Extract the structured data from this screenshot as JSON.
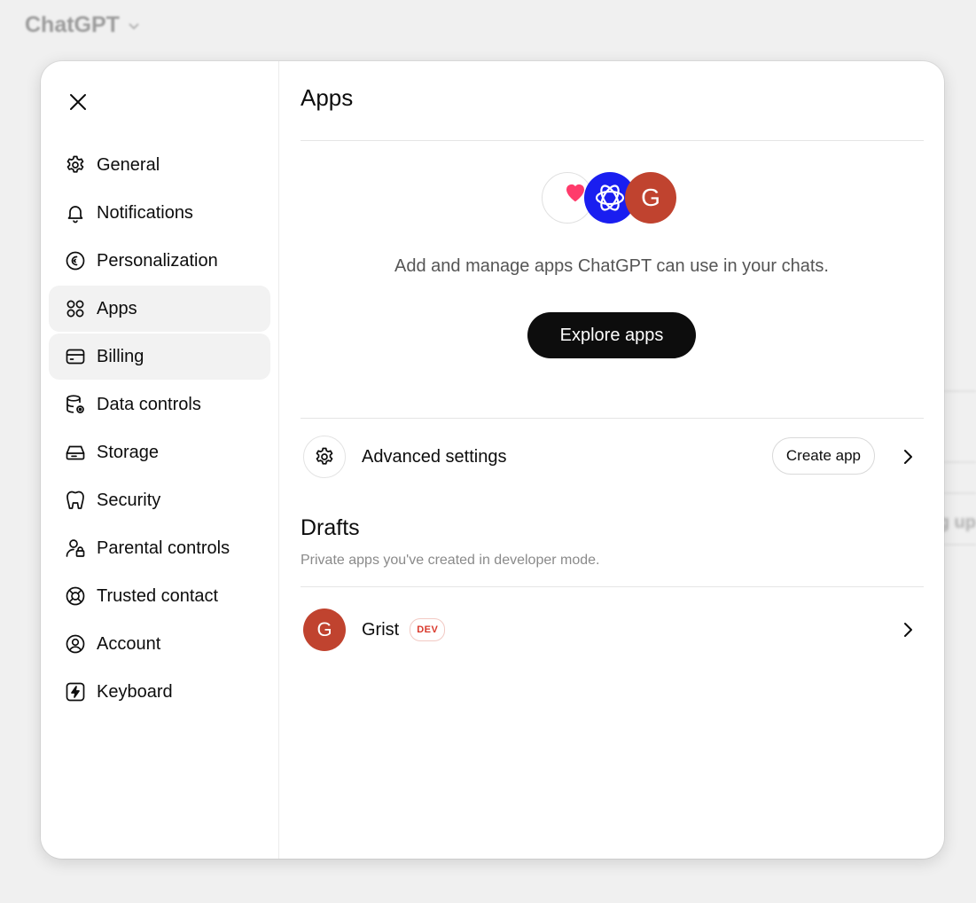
{
  "app": {
    "title": "ChatGPT",
    "bg_fragment": "g up"
  },
  "sidebar": {
    "items": [
      {
        "label": "General",
        "icon": "gear-icon"
      },
      {
        "label": "Notifications",
        "icon": "bell-icon"
      },
      {
        "label": "Personalization",
        "icon": "personalization-icon"
      },
      {
        "label": "Apps",
        "icon": "apps-grid-icon"
      },
      {
        "label": "Billing",
        "icon": "credit-card-icon"
      },
      {
        "label": "Data controls",
        "icon": "database-icon"
      },
      {
        "label": "Storage",
        "icon": "storage-drive-icon"
      },
      {
        "label": "Security",
        "icon": "security-icon"
      },
      {
        "label": "Parental controls",
        "icon": "user-lock-icon"
      },
      {
        "label": "Trusted contact",
        "icon": "lifebuoy-icon"
      },
      {
        "label": "Account",
        "icon": "user-circle-icon"
      },
      {
        "label": "Keyboard",
        "icon": "lightning-icon"
      }
    ]
  },
  "main": {
    "title": "Apps",
    "hero": {
      "description": "Add and manage apps ChatGPT can use in your chats.",
      "explore_label": "Explore apps",
      "grist_initial": "G",
      "colors": {
        "openai": "#1a1ef0",
        "grist": "#c0432f"
      }
    },
    "advanced": {
      "label": "Advanced settings",
      "create_label": "Create app"
    },
    "drafts": {
      "title": "Drafts",
      "subtitle": "Private apps you've created in developer mode.",
      "items": [
        {
          "initial": "G",
          "name": "Grist",
          "badge": "DEV"
        }
      ]
    }
  }
}
